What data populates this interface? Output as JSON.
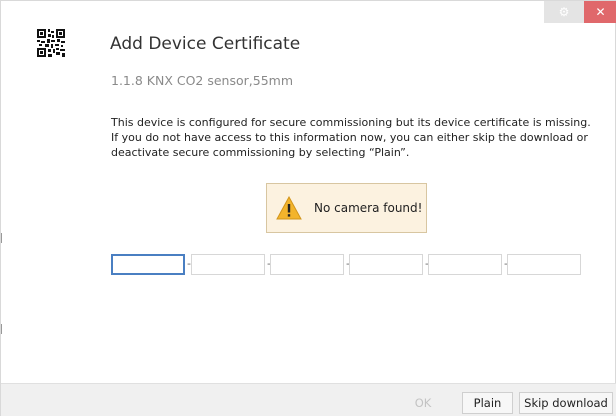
{
  "window": {
    "settings_icon": "gear-icon",
    "settings_glyph": "⚙",
    "close_icon": "close-icon",
    "close_glyph": "✕",
    "close_color": "#e0686b"
  },
  "header": {
    "icon": "qr-code-icon",
    "title": "Add Device Certificate",
    "device": "1.1.8 KNX CO2 sensor,55mm"
  },
  "message": {
    "line1": "This device is configured for secure commissioning but its device certificate is missing.",
    "line2": "If you do not have access to this information now, you can either skip the download or",
    "line3": "deactivate secure commissioning by selecting “Plain”."
  },
  "alert": {
    "icon": "warning-icon",
    "text": "No camera found!",
    "background": "#fcf2e0"
  },
  "certificate": {
    "fields": [
      "",
      "",
      "",
      "",
      "",
      ""
    ],
    "separator": "-"
  },
  "footer": {
    "ok_label": "OK",
    "plain_label": "Plain",
    "skip_label": "Skip download"
  }
}
